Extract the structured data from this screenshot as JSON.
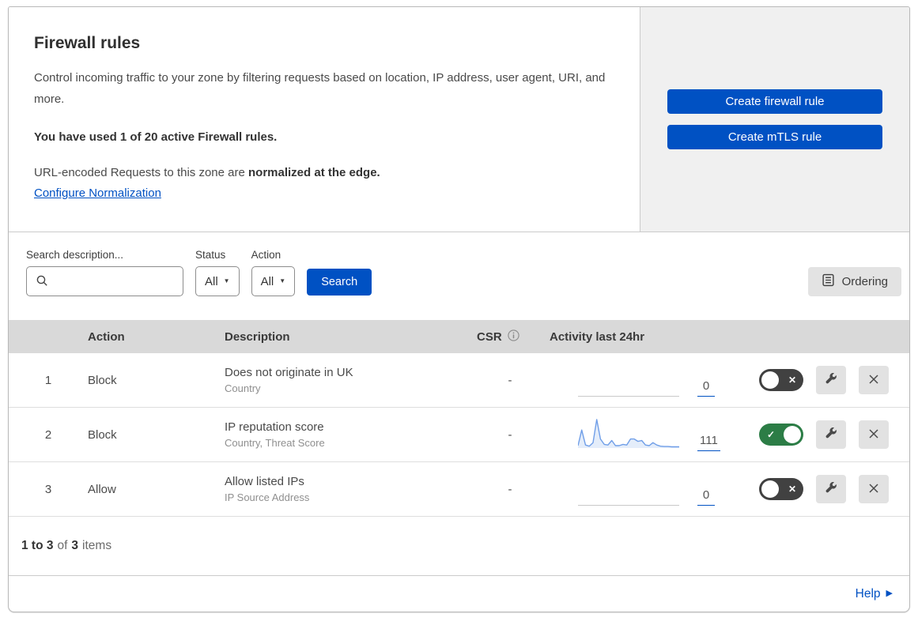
{
  "header": {
    "title": "Firewall rules",
    "description": "Control incoming traffic to your zone by filtering requests based on location, IP address, user agent, URI, and more.",
    "usage_text": "You have used 1 of 20 active Firewall rules.",
    "normalization_prefix": "URL-encoded Requests to this zone are",
    "normalization_bold": "normalized at the edge.",
    "normalization_link": "Configure Normalization"
  },
  "actions_panel": {
    "create_firewall_rule": "Create firewall rule",
    "create_mtls_rule": "Create mTLS rule"
  },
  "filters": {
    "search_label": "Search description...",
    "status_label": "Status",
    "status_value": "All",
    "action_label": "Action",
    "action_value": "All",
    "search_button": "Search",
    "ordering_button": "Ordering"
  },
  "table": {
    "headers": {
      "action": "Action",
      "description": "Description",
      "csr": "CSR",
      "activity": "Activity last 24hr"
    },
    "rows": [
      {
        "num": "1",
        "action": "Block",
        "description": "Does not originate in UK",
        "match_fields": "Country",
        "csr": "-",
        "activity_count": "0",
        "enabled": false,
        "sparkline": "flat"
      },
      {
        "num": "2",
        "action": "Block",
        "description": "IP reputation score",
        "match_fields": "Country, Threat Score",
        "csr": "-",
        "activity_count": "111",
        "enabled": true,
        "sparkline": "data",
        "sparkline_points": [
          8,
          60,
          10,
          6,
          18,
          95,
          30,
          12,
          10,
          25,
          8,
          8,
          12,
          10,
          30,
          30,
          22,
          25,
          10,
          8,
          18,
          10,
          6,
          5,
          5,
          4,
          4,
          4
        ]
      },
      {
        "num": "3",
        "action": "Allow",
        "description": "Allow listed IPs",
        "match_fields": "IP Source Address",
        "csr": "-",
        "activity_count": "0",
        "enabled": false,
        "sparkline": "flat"
      }
    ]
  },
  "pagination": {
    "range": "1 to 3",
    "of": "of",
    "total": "3",
    "items": "items"
  },
  "help": {
    "label": "Help"
  },
  "icons": {
    "toggle_on_glyph": "✓",
    "toggle_off_glyph": "✕",
    "dropdown_caret": "▼",
    "help_arrow": "▶"
  },
  "colors": {
    "primary_blue": "#0051c3",
    "toggle_on_green": "#2c7d46",
    "toggle_off_gray": "#414141",
    "sparkline_stroke": "#6f9ee8",
    "sparkline_fill": "#e4edfa",
    "table_header_bg": "#d9d9d9",
    "panel_bg": "#f0f0f0"
  }
}
